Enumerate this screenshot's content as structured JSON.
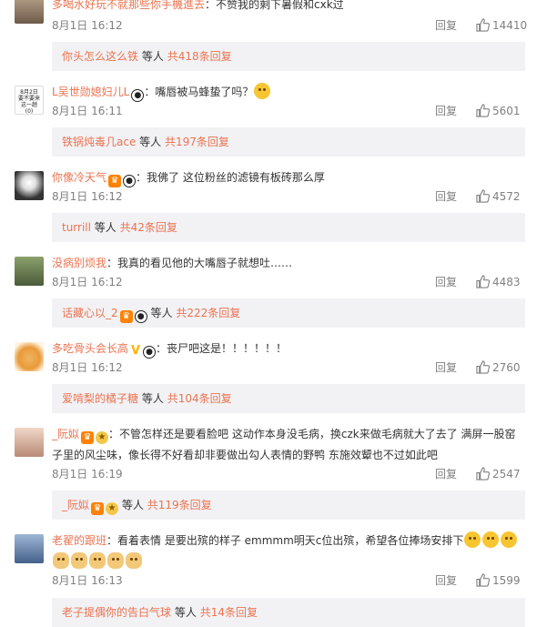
{
  "ui": {
    "reply_label": "回复",
    "others_label": "等人"
  },
  "comments": [
    {
      "user": "多喝水好玩不就那些你手機進去",
      "separator": "：",
      "text": "不赞我的剩下暑假和cxk过",
      "time": "8月1日 16:12",
      "likes": "14410",
      "sub": {
        "user": "你头怎么这么铁",
        "reply_count": "共418条回复"
      }
    },
    {
      "user": "L吴世勋媳妇儿L",
      "separator": "：",
      "text": "嘴唇被马蜂蛰了吗？",
      "time": "8月1日 16:11",
      "likes": "5601",
      "avatar_text": "8月2日\n要不要来这一趟\n(0)",
      "sub": {
        "user": "铁锅炖毒几ace",
        "reply_count": "共197条回复"
      }
    },
    {
      "user": "你像冷天气",
      "separator": "：",
      "text": "我佛了 这位粉丝的滤镜有板砖那么厚",
      "time": "8月1日 16:12",
      "likes": "4572",
      "sub": {
        "user": "turrill",
        "reply_count": "共42条回复"
      }
    },
    {
      "user": "没病别烦我",
      "separator": "：",
      "text": "我真的看见他的大嘴唇子就想吐……",
      "time": "8月1日 16:12",
      "likes": "4483",
      "sub": {
        "user": "话藏心以_2",
        "reply_count": "共222条回复"
      }
    },
    {
      "user": "多吃骨头会长高",
      "separator": "：",
      "text": "丧尸吧这是！！！！！！",
      "time": "8月1日 16:12",
      "likes": "2760",
      "sub": {
        "user": "爱啃梨的橘子糖",
        "reply_count": "共104条回复"
      }
    },
    {
      "user": "_阮姒",
      "separator": "：",
      "text": "不管怎样还是要看脸吧  这动作本身没毛病，换czk来做毛病就大了去了  满屏一股窑子里的风尘味，像长得不好看却非要做出勾人表情的野鸭  东施效颦也不过如此吧",
      "time": "8月1日 16:19",
      "likes": "2547",
      "sub": {
        "user": "_阮姒",
        "reply_count": "共119条回复"
      }
    },
    {
      "user": "老翟的跟班",
      "separator": "：",
      "text": "看着表情  是要出殡的样子  emmmm明天c位出殡，希望各位捧场安排下",
      "time": "8月1日 16:13",
      "likes": "1599",
      "sub": {
        "user": "老子提偶你的告白气球",
        "reply_count": "共14条回复"
      }
    }
  ]
}
